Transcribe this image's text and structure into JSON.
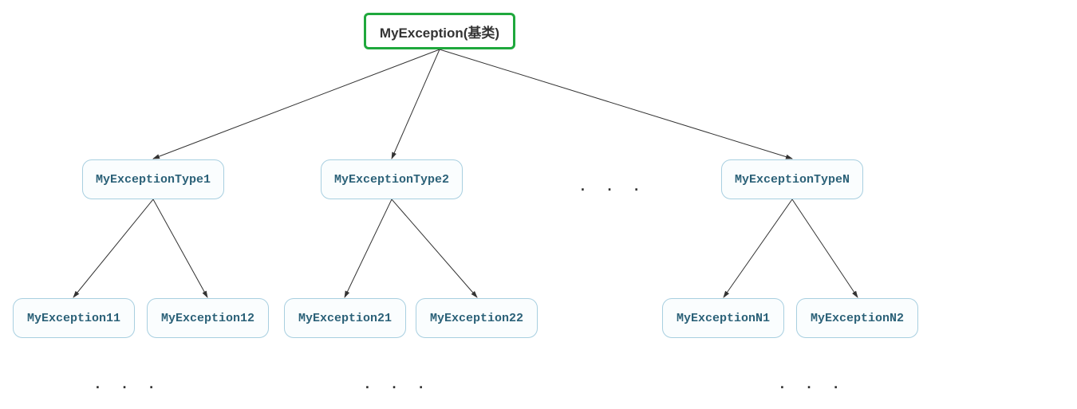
{
  "root": {
    "label": "MyException(基类)"
  },
  "level1": {
    "n1": "MyExceptionType1",
    "n2": "MyExceptionType2",
    "nN": "MyExceptionTypeN"
  },
  "level2": {
    "n11": "MyException11",
    "n12": "MyException12",
    "n21": "MyException21",
    "n22": "MyException22",
    "nN1": "MyExceptionN1",
    "nN2": "MyExceptionN2"
  },
  "ellipsis": ". . .",
  "colors": {
    "rootBorder": "#1fa83c",
    "childBorder": "#a8cfe0",
    "childText": "#2b6178"
  }
}
